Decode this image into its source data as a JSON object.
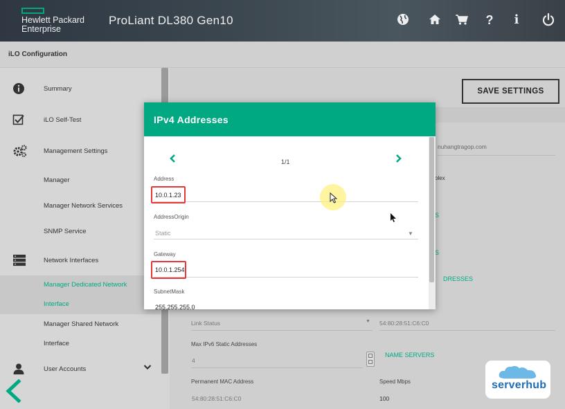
{
  "header": {
    "brand_line1": "Hewlett Packard",
    "brand_line2": "Enterprise",
    "product": "ProLiant DL380 Gen10",
    "icons": [
      "globe-icon",
      "home-icon",
      "cart-icon",
      "help-icon",
      "info-icon",
      "power-icon"
    ]
  },
  "subheader": {
    "title": "iLO Configuration"
  },
  "sidebar": {
    "items": [
      {
        "label": "Summary",
        "icon": "info-icon"
      },
      {
        "label": "iLO Self-Test",
        "icon": "checkbox-icon"
      },
      {
        "label": "Management Settings",
        "icon": "gears-icon"
      },
      {
        "label": "Manager"
      },
      {
        "label": "Manager Network Services"
      },
      {
        "label": "SNMP Service"
      },
      {
        "label": "Network Interfaces",
        "icon": "network-icon"
      },
      {
        "label": "Manager Dedicated Network"
      },
      {
        "label": "Interface"
      },
      {
        "label": "Manager Shared Network"
      },
      {
        "label": "Interface"
      },
      {
        "label": "User Accounts",
        "icon": "user-icon"
      }
    ]
  },
  "main": {
    "save_label": "SAVE SETTINGS",
    "bg_email": "nuhangtragop.com",
    "bg_duplex": "olex",
    "bg_addresses": "DRESSES",
    "bg_link_status": "Link Status",
    "bg_mac1": "54:80:28:51:C6:C0",
    "bg_max_ipv6": "Max IPv6 Static Addresses",
    "bg_max_val": "4",
    "bg_name_servers": "NAME SERVERS",
    "bg_perm_mac_label": "Permanent MAC Address",
    "bg_perm_mac_val": "54:80:28:51:C6:C0",
    "bg_speed_label": "Speed Mbps",
    "bg_speed_val": "100"
  },
  "dialog": {
    "title": "IPv4 Addresses",
    "pager": "1/1",
    "fields": [
      {
        "label": "Address",
        "value": "10.0.1.23"
      },
      {
        "label": "AddressOrigin",
        "value": "Static"
      },
      {
        "label": "Gateway",
        "value": "10.0.1.254"
      },
      {
        "label": "SubnetMask",
        "value": "255.255.255.0"
      }
    ]
  },
  "badge": {
    "text": "serverhub"
  },
  "colors": {
    "accent": "#01a982",
    "highlight": "#e53935",
    "badge_blue": "#1e6fb8"
  }
}
